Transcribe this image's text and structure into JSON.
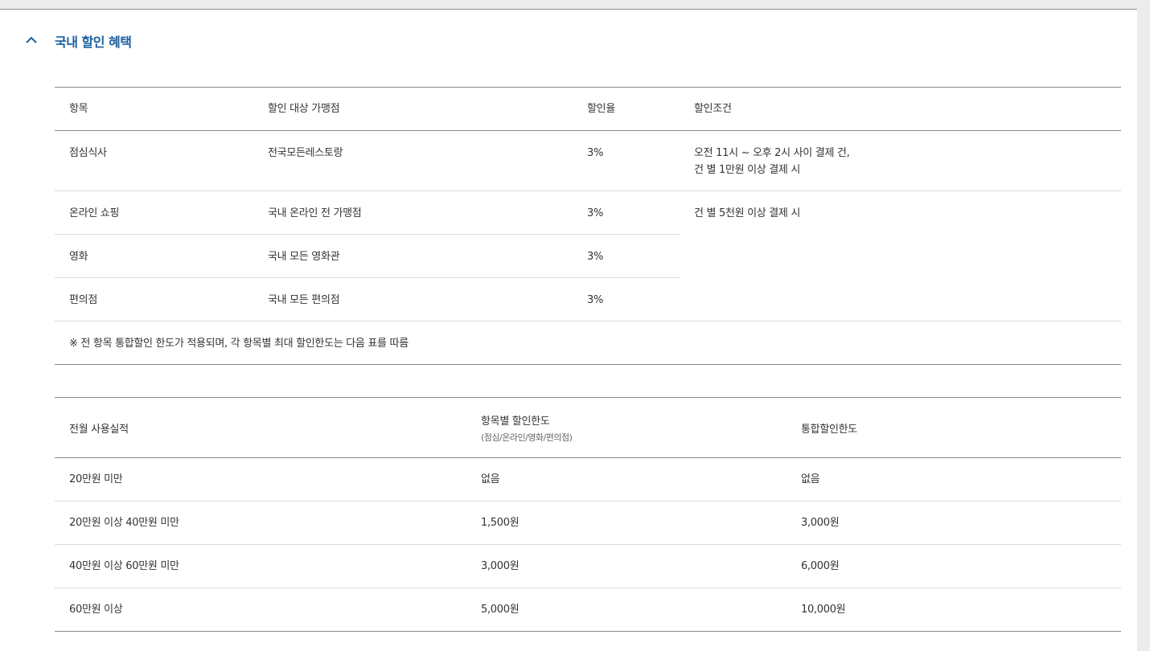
{
  "section": {
    "title": "국내 할인 혜택",
    "accent_color": "#1a5f9e",
    "toggle_icon": "chevron-up-icon"
  },
  "benefit_table": {
    "headers": [
      "항목",
      "할인 대상 가맹점",
      "할인율",
      "할인조건"
    ],
    "rows": [
      {
        "item": "점심식사",
        "merchant": "전국모든레스토랑",
        "rate": "3%",
        "condition_line1": "오전 11시 ~ 오후 2시 사이 결제 건,",
        "condition_line2": "건 별 1만원 이상 결제 시"
      },
      {
        "item": "온라인 쇼핑",
        "merchant": "국내 온라인 전 가맹점",
        "rate": "3%",
        "condition_line1": "건 별 5천원 이상 결제 시"
      },
      {
        "item": "영화",
        "merchant": "국내 모든 영화관",
        "rate": "3%"
      },
      {
        "item": "편의점",
        "merchant": "국내 모든 편의점",
        "rate": "3%"
      }
    ],
    "note": "※ 전 항목 통합할인 한도가 적용되며, 각 항목별 최대 할인한도는 다음 표를 따름"
  },
  "limit_table": {
    "headers": {
      "usage": "전월 사용실적",
      "per_item": "항목별 할인한도",
      "per_item_sub": "(점심/온라인/영화/편의점)",
      "total": "통합할인한도"
    },
    "rows": [
      {
        "usage": "20만원 미만",
        "per_item": "없음",
        "total": "없음"
      },
      {
        "usage": "20만원 이상 40만원 미만",
        "per_item": "1,500원",
        "total": "3,000원"
      },
      {
        "usage": "40만원 이상 60만원 미만",
        "per_item": "3,000원",
        "total": "6,000원"
      },
      {
        "usage": "60만원 이상",
        "per_item": "5,000원",
        "total": "10,000원"
      }
    ]
  }
}
